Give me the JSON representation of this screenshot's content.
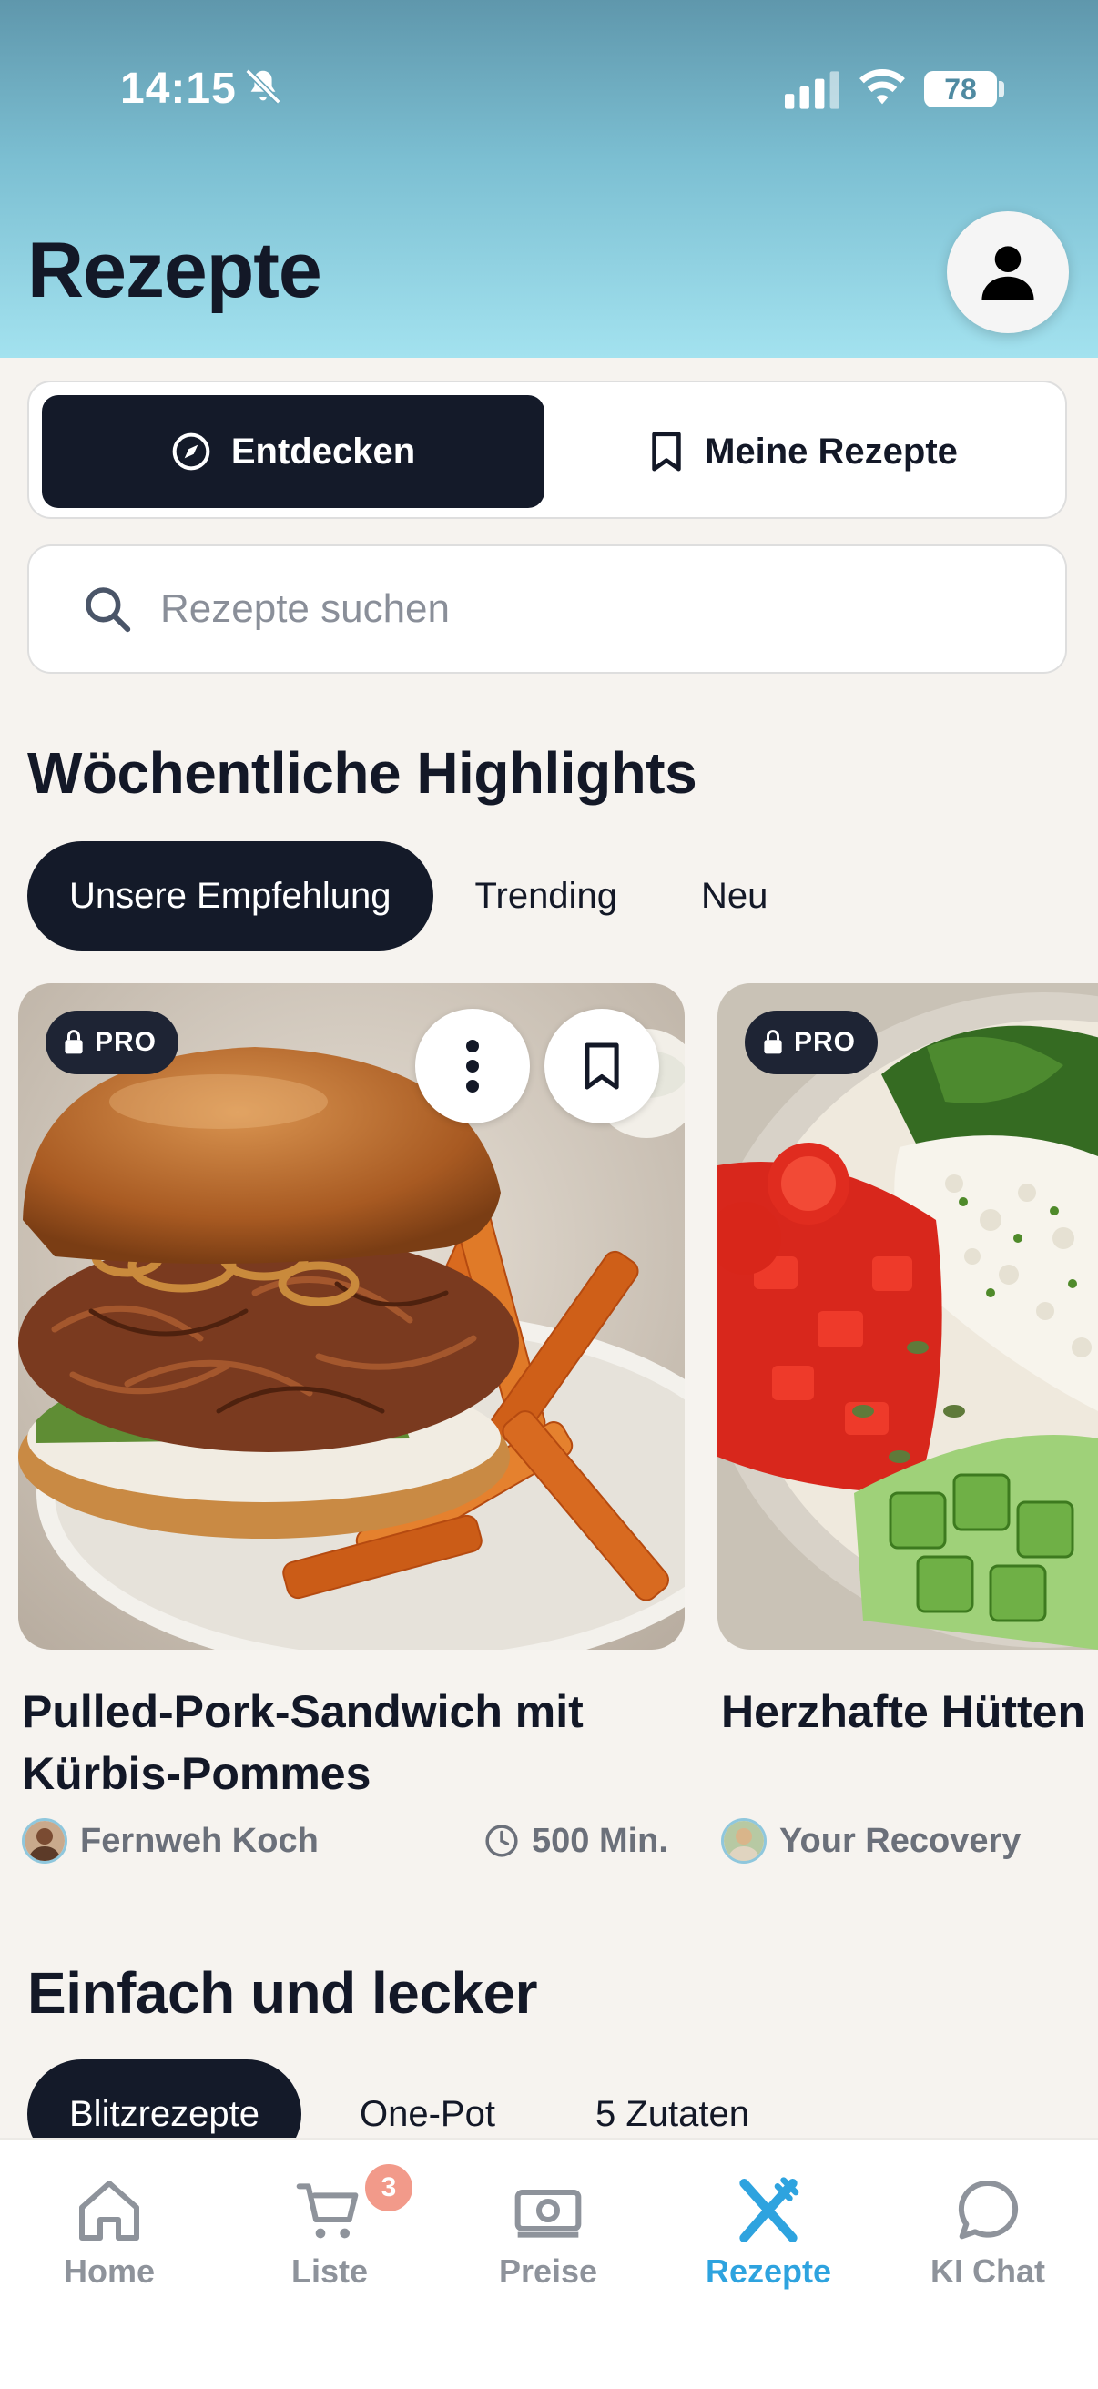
{
  "status_bar": {
    "time": "14:15",
    "battery": "78"
  },
  "header": {
    "title": "Rezepte"
  },
  "segment": {
    "discover": "Entdecken",
    "my_recipes": "Meine Rezepte"
  },
  "search": {
    "placeholder": "Rezepte suchen"
  },
  "highlights": {
    "title": "Wöchentliche Highlights",
    "tabs": [
      "Unsere Empfehlung",
      "Trending",
      "Neu"
    ]
  },
  "cards": [
    {
      "badge": "PRO",
      "title_line1": "Pulled-Pork-Sandwich mit",
      "title_line2": "Kürbis-Pommes",
      "author": "Fernweh Koch",
      "duration": "500 Min."
    },
    {
      "badge": "PRO",
      "title_line1": "Herzhafte Hütten",
      "title_line2": "",
      "author": "Your Recovery",
      "duration": ""
    }
  ],
  "easy": {
    "title": "Einfach und lecker",
    "tabs": [
      "Blitzrezepte",
      "One-Pot",
      "5 Zutaten"
    ]
  },
  "nav": {
    "items": [
      "Home",
      "Liste",
      "Preise",
      "Rezepte",
      "KI Chat"
    ],
    "cart_badge": "3",
    "active": "Rezepte"
  },
  "colors": {
    "accent": "#2ea3df",
    "dark": "#141a29",
    "badge": "#f29a8a"
  }
}
